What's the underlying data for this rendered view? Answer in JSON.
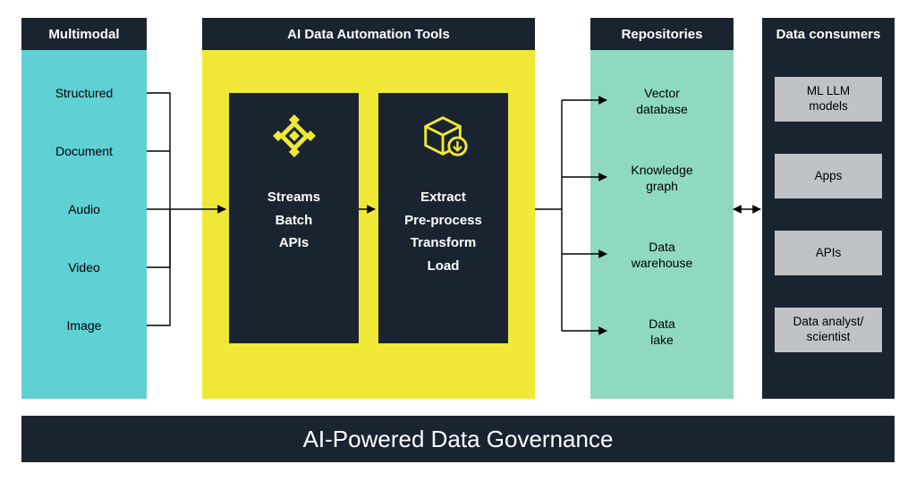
{
  "columns": {
    "multimodal": {
      "title": "Multimodal",
      "items": [
        "Structured",
        "Document",
        "Audio",
        "Video",
        "Image"
      ]
    },
    "ai_tools": {
      "title": "AI Data Automation Tools",
      "card1": {
        "lines": [
          "Streams",
          "Batch",
          "APIs"
        ],
        "icon": "diamond-grid-icon"
      },
      "card2": {
        "lines": [
          "Extract",
          "Pre-process",
          "Transform",
          "Load"
        ],
        "icon": "cube-download-icon"
      }
    },
    "repositories": {
      "title": "Repositories",
      "items": [
        "Vector database",
        "Knowledge graph",
        "Data warehouse",
        "Data lake"
      ]
    },
    "consumers": {
      "title": "Data consumers",
      "items": [
        "ML LLM models",
        "Apps",
        "APIs",
        "Data analyst/ scientist"
      ]
    }
  },
  "footer": "AI-Powered Data Governance",
  "colors": {
    "dark": "#1a2430",
    "cyan": "#5fd0d4",
    "yellow": "#f0e836",
    "mint": "#8fd9c1",
    "gray": "#bfc2c6"
  }
}
